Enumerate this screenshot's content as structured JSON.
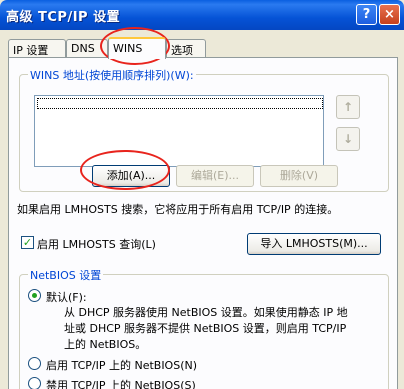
{
  "window": {
    "title": "高级 TCP/IP 设置",
    "help": "?",
    "close": "×"
  },
  "tabs": [
    {
      "label": "IP 设置"
    },
    {
      "label": "DNS"
    },
    {
      "label": "WINS"
    },
    {
      "label": "选项"
    }
  ],
  "wins_group": {
    "legend": "WINS 地址(按使用顺序排列)(W):",
    "up": "↑",
    "down": "↓",
    "add": "添加(A)...",
    "edit": "编辑(E)...",
    "remove": "删除(V)"
  },
  "lmhosts": {
    "info": "如果启用 LMHOSTS 搜索，它将应用于所有启用 TCP/IP 的连接。",
    "check_label": "启用 LMHOSTS 查询(L)",
    "import": "导入 LMHOSTS(M)..."
  },
  "netbios_group": {
    "legend": "NetBIOS 设置",
    "default_label": "默认(F):",
    "default_desc_1": "从 DHCP 服务器使用 NetBIOS 设置。如果使用静态 IP 地",
    "default_desc_2": "址或 DHCP 服务器不提供 NetBIOS 设置，则启用 TCP/IP",
    "default_desc_3": "上的 NetBIOS。",
    "enable_label": "启用 TCP/IP 上的 NetBIOS(N)",
    "disable_label": "禁用 TCP/IP 上的 NetBIOS(S)"
  },
  "colors": {
    "title_blue": "#0553d6",
    "annotation_red": "#e8241d",
    "check_green": "#21a121"
  }
}
